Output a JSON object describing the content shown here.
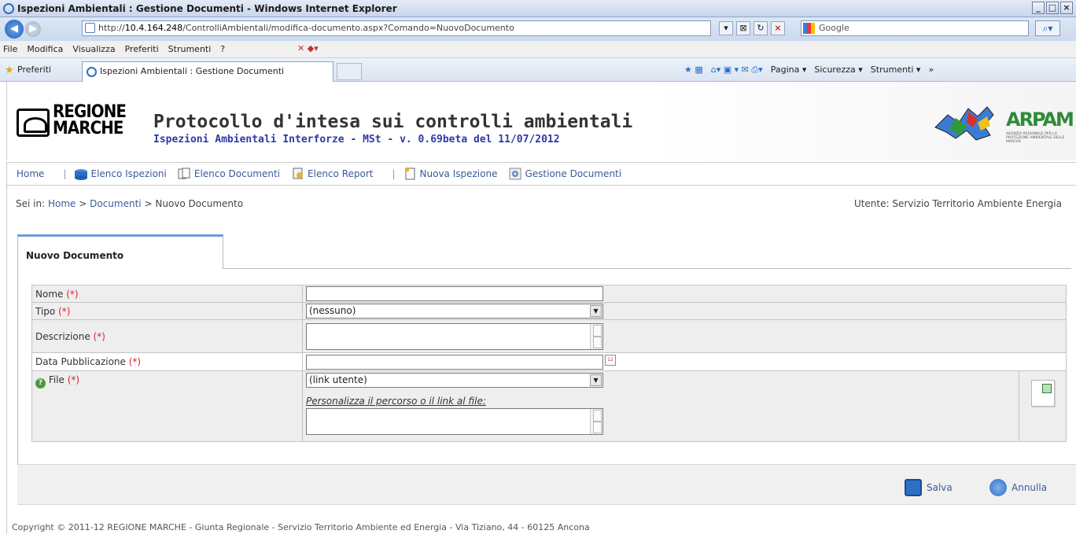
{
  "window": {
    "title": "Ispezioni Ambientali : Gestione Documenti - Windows Internet Explorer"
  },
  "addressbar": {
    "url_prefix": "http://",
    "url_host": "10.4.164.248",
    "url_path": "/ControlliAmbientali/modifica-documento.aspx?Comando=NuovoDocumento",
    "search_placeholder": "Google"
  },
  "menubar": {
    "items": [
      "File",
      "Modifica",
      "Visualizza",
      "Preferiti",
      "Strumenti",
      "?"
    ]
  },
  "favbar": {
    "favorites_label": "Preferiti",
    "tab_title": "Ispezioni Ambientali : Gestione Documenti",
    "cmd": {
      "pagina": "Pagina ▾",
      "sicurezza": "Sicurezza ▾",
      "strumenti": "Strumenti ▾"
    }
  },
  "header": {
    "logo_line1": "REGIONE",
    "logo_line2": "MARCHE",
    "title": "Protocollo d'intesa sui controlli ambientali",
    "subtitle": "Ispezioni Ambientali Interforze - MSt - v. 0.69beta del 11/07/2012",
    "arpam_logo_text": "ARPAM",
    "arpam_small": "AGENZIA REGIONALE PER LA PROTEZIONE AMBIENTALE DELLE MARCHE"
  },
  "nav": {
    "home": "Home",
    "elenco_ispezioni": "Elenco Ispezioni",
    "elenco_documenti": "Elenco Documenti",
    "elenco_report": "Elenco Report",
    "nuova_ispezione": "Nuova Ispezione",
    "gestione_documenti": "Gestione Documenti"
  },
  "breadcrumb": {
    "prefix": "Sei in:",
    "home": "Home",
    "sep": ">",
    "documenti": "Documenti",
    "current": "Nuovo Documento"
  },
  "user": "Utente: Servizio Territorio Ambiente Energia",
  "form": {
    "tab_label": "Nuovo Documento",
    "required_mark": "(*)",
    "nome_label": "Nome",
    "tipo_label": "Tipo",
    "tipo_value": "(nessuno)",
    "descrizione_label": "Descrizione",
    "data_label": "Data Pubblicazione",
    "file_label": "File",
    "file_value": "(link utente)",
    "file_hint": "Personalizza il percorso o il link al file:"
  },
  "actions": {
    "save": "Salva",
    "cancel": "Annulla"
  },
  "footer": "Copyright © 2011-12 REGIONE MARCHE - Giunta Regionale - Servizio Territorio Ambiente ed Energia - Via Tiziano, 44 - 60125 Ancona"
}
